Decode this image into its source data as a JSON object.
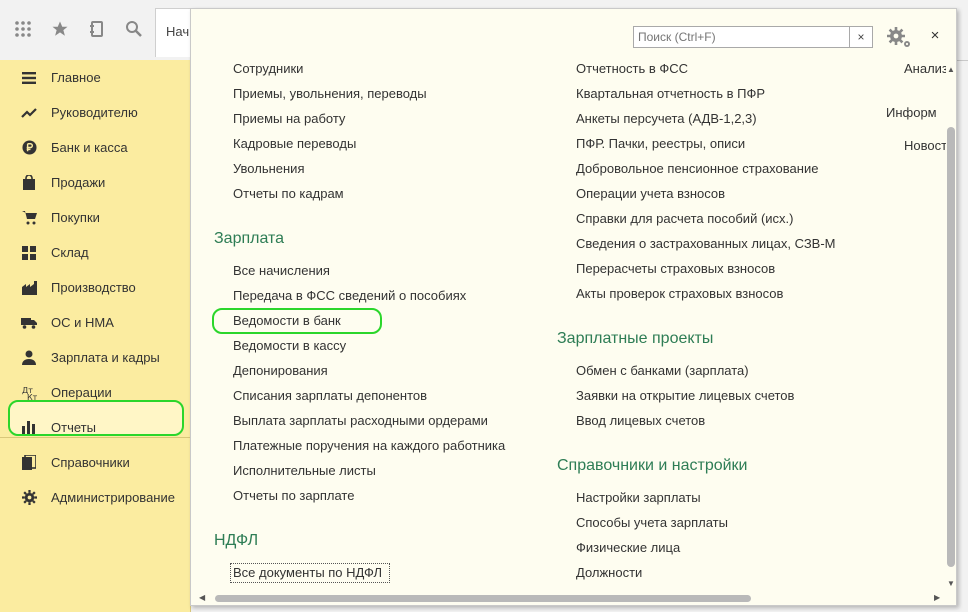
{
  "toolbar": {
    "tab_label": "Нач"
  },
  "sidebar": {
    "items": [
      {
        "label": "Главное",
        "icon": "menu-lines-icon"
      },
      {
        "label": "Руководителю",
        "icon": "trend-icon"
      },
      {
        "label": "Банк и касса",
        "icon": "ruble-icon"
      },
      {
        "label": "Продажи",
        "icon": "bag-icon"
      },
      {
        "label": "Покупки",
        "icon": "cart-icon"
      },
      {
        "label": "Склад",
        "icon": "warehouse-icon"
      },
      {
        "label": "Производство",
        "icon": "factory-icon"
      },
      {
        "label": "ОС и НМА",
        "icon": "truck-icon"
      },
      {
        "label": "Зарплата и кадры",
        "icon": "person-icon"
      },
      {
        "label": "Операции",
        "icon": "operations-icon"
      },
      {
        "label": "Отчеты",
        "icon": "bar-chart-icon"
      },
      {
        "label": "Справочники",
        "icon": "books-icon"
      },
      {
        "label": "Администрирование",
        "icon": "gear-icon"
      }
    ]
  },
  "panel": {
    "search_placeholder": "Поиск (Ctrl+F)",
    "clear_label": "×",
    "close_label": "×",
    "col1": {
      "top_links": [
        "Сотрудники",
        "Приемы, увольнения, переводы",
        "Приемы на работу",
        "Кадровые переводы",
        "Увольнения",
        "Отчеты по кадрам"
      ],
      "salary_header": "Зарплата",
      "salary_links": [
        "Все начисления",
        "Передача в ФСС сведений о пособиях",
        "Ведомости в банк",
        "Ведомости в кассу",
        "Депонирования",
        "Списания зарплаты депонентов",
        "Выплата зарплаты расходными ордерами",
        "Платежные поручения на каждого работника",
        "Исполнительные листы",
        "Отчеты по зарплате"
      ],
      "ndfl_header": "НДФЛ",
      "ndfl_links": [
        "Все документы по НДФЛ"
      ]
    },
    "col2": {
      "top_links": [
        "Отчетность в ФСС",
        "Квартальная отчетность в ПФР",
        "Анкеты персучета (АДВ-1,2,3)",
        "ПФР. Пачки, реестры, описи",
        "Добровольное пенсионное страхование",
        "Операции учета взносов",
        "Справки для расчета пособий (исх.)",
        "Сведения о застрахованных лицах, СЗВ-М",
        "Перерасчеты страховых взносов",
        "Акты проверок страховых взносов"
      ],
      "projects_header": "Зарплатные проекты",
      "projects_links": [
        "Обмен с банками (зарплата)",
        "Заявки на открытие лицевых счетов",
        "Ввод лицевых счетов"
      ],
      "settings_header": "Справочники и настройки",
      "settings_links": [
        "Настройки зарплаты",
        "Способы учета зарплаты",
        "Физические лица",
        "Должности"
      ]
    },
    "col3": {
      "link1": "Анализ",
      "header": "Информ",
      "link2": "Новост"
    }
  }
}
